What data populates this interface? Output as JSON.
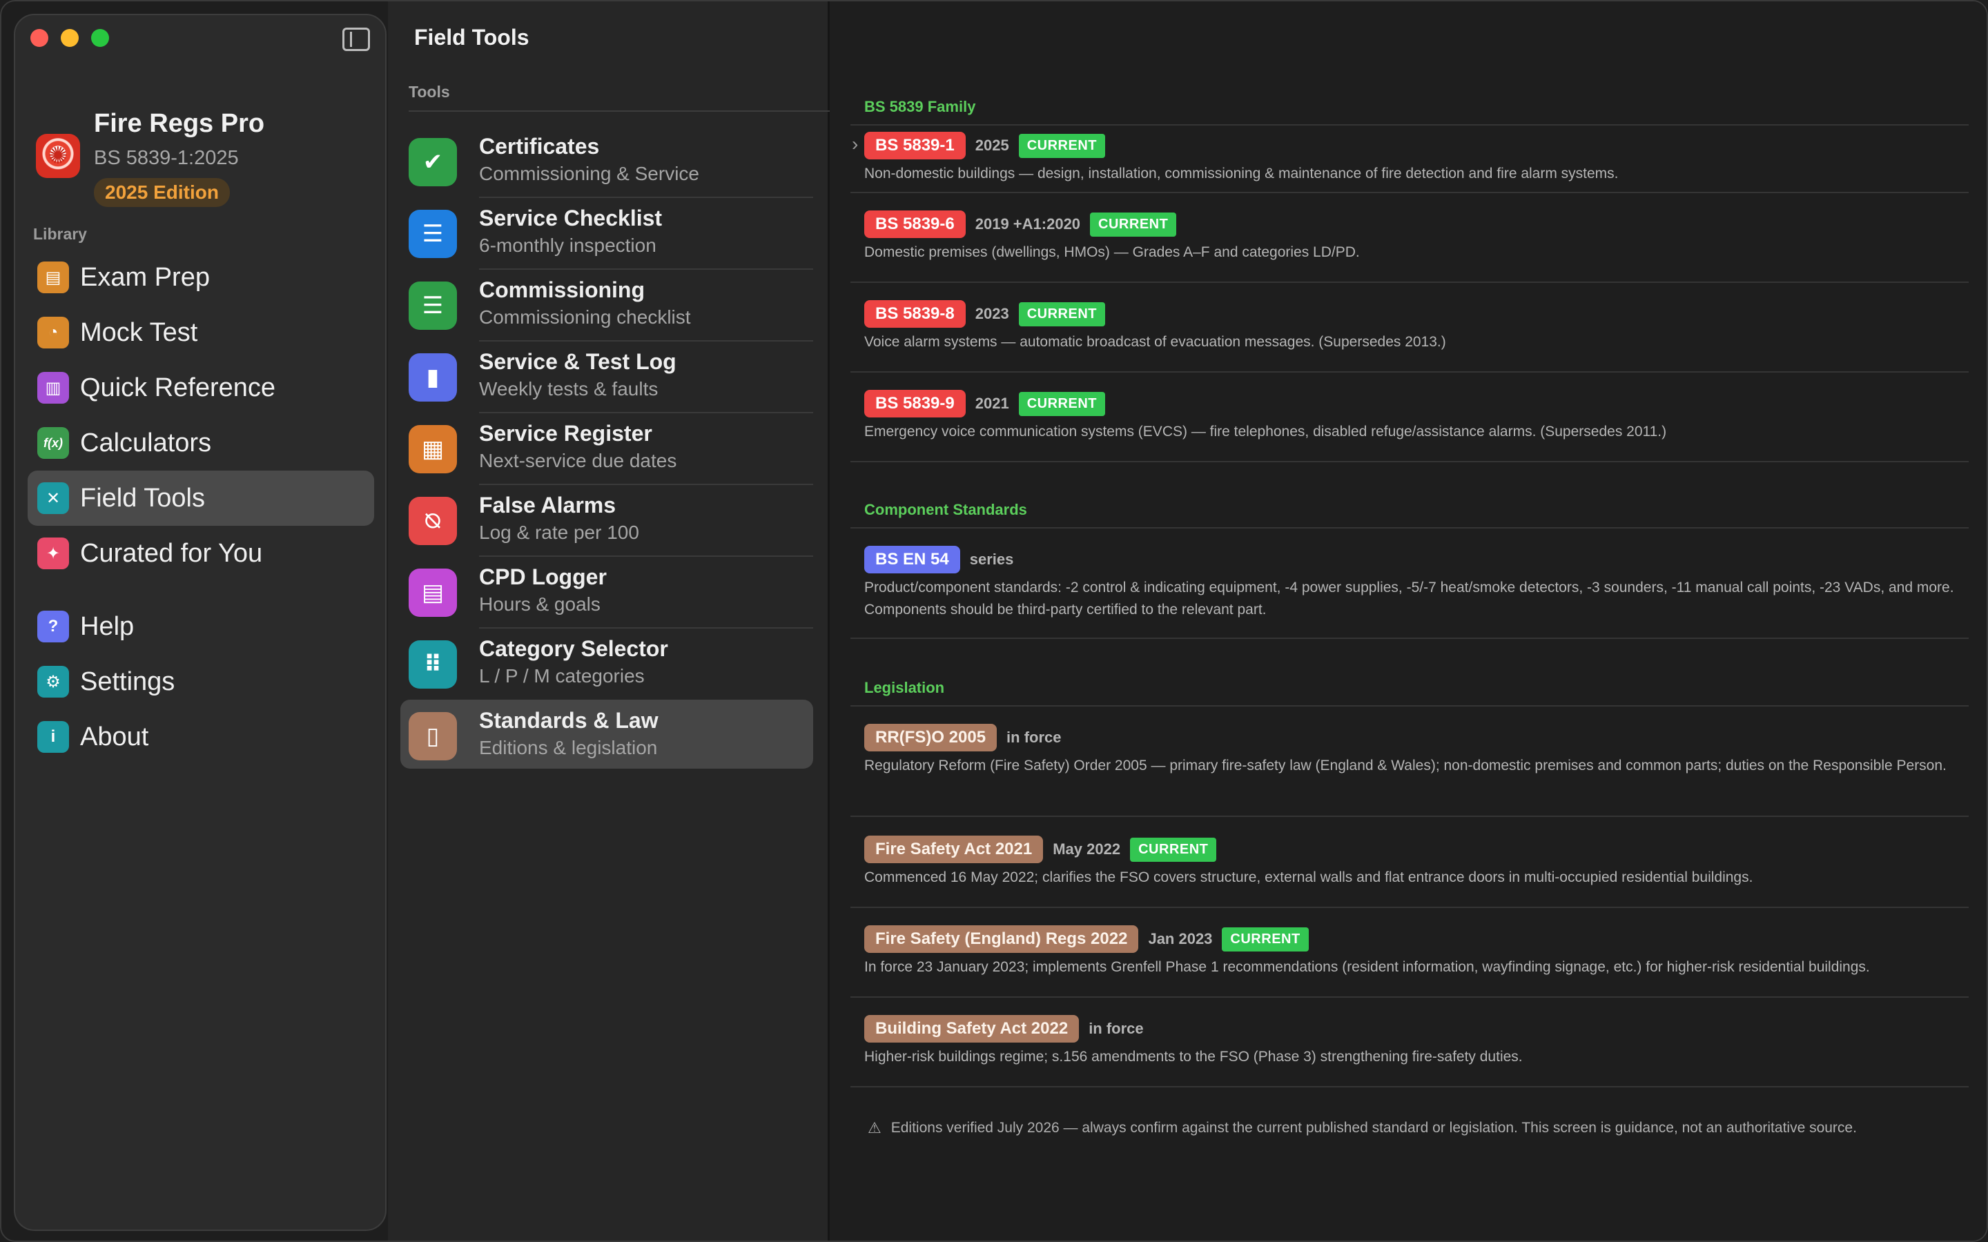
{
  "sidebar": {
    "app_title": "Fire Regs Pro",
    "app_subtitle": "BS 5839-1:2025",
    "edition_badge": "2025 Edition",
    "library_label": "Library",
    "items": [
      {
        "label": "Exam Prep",
        "icon": "clipboard-icon",
        "color": "#d9892b"
      },
      {
        "label": "Mock Test",
        "icon": "timer-icon",
        "color": "#d9892b"
      },
      {
        "label": "Quick Reference",
        "icon": "books-icon",
        "color": "#a551d6"
      },
      {
        "label": "Calculators",
        "icon": "function-icon",
        "color": "#3b9a4d"
      },
      {
        "label": "Field Tools",
        "icon": "wrench-screwdriver-icon",
        "color": "#1c9aa3"
      },
      {
        "label": "Curated for You",
        "icon": "sparkle-icon",
        "color": "#e84a6a"
      }
    ],
    "footer_items": [
      {
        "label": "Help",
        "icon": "question-icon",
        "color": "#6672f0"
      },
      {
        "label": "Settings",
        "icon": "gear-icon",
        "color": "#1c9aa3"
      },
      {
        "label": "About",
        "icon": "info-icon",
        "color": "#1c9aa3"
      }
    ],
    "active": "Field Tools"
  },
  "middle": {
    "title": "Field Tools",
    "tools_label": "Tools",
    "tools": [
      {
        "title": "Certificates",
        "subtitle": "Commissioning & Service",
        "icon": "check-seal-icon",
        "color": "#2f9e48"
      },
      {
        "title": "Service Checklist",
        "subtitle": "6-monthly inspection",
        "icon": "checklist-icon",
        "color": "#1f7fe0"
      },
      {
        "title": "Commissioning",
        "subtitle": "Commissioning checklist",
        "icon": "checklist-icon",
        "color": "#2f9e48"
      },
      {
        "title": "Service & Test Log",
        "subtitle": "Weekly tests & faults",
        "icon": "book-icon",
        "color": "#5b6ee8"
      },
      {
        "title": "Service Register",
        "subtitle": "Next-service due dates",
        "icon": "calendar-clock-icon",
        "color": "#d9782b"
      },
      {
        "title": "False Alarms",
        "subtitle": "Log & rate per 100",
        "icon": "bell-slash-icon",
        "color": "#e54848"
      },
      {
        "title": "CPD Logger",
        "subtitle": "Hours & goals",
        "icon": "document-icon",
        "color": "#c14ad6"
      },
      {
        "title": "Category Selector",
        "subtitle": "L / P / M categories",
        "icon": "grid-icon",
        "color": "#1c9aa3"
      },
      {
        "title": "Standards & Law",
        "subtitle": "Editions & legislation",
        "icon": "book-closed-icon",
        "color": "#a9795f"
      }
    ],
    "active": "Standards & Law"
  },
  "detail": {
    "groups": [
      {
        "title": "BS 5839 Family"
      },
      {
        "title": "Component Standards"
      },
      {
        "title": "Legislation"
      }
    ],
    "current_label": "CURRENT",
    "entries": [
      {
        "code": "BS 5839-1",
        "year": "2025",
        "current": true,
        "desc": "Non-domestic buildings — design, installation, commissioning & maintenance of fire detection and fire alarm systems."
      },
      {
        "code": "BS 5839-6",
        "year": "2019 +A1:2020",
        "current": true,
        "desc": "Domestic premises (dwellings, HMOs) — Grades A–F and categories LD/PD."
      },
      {
        "code": "BS 5839-8",
        "year": "2023",
        "current": true,
        "desc": "Voice alarm systems — automatic broadcast of evacuation messages. (Supersedes 2013.)"
      },
      {
        "code": "BS 5839-9",
        "year": "2021",
        "current": true,
        "desc": "Emergency voice communication systems (EVCS) — fire telephones, disabled refuge/assistance alarms. (Supersedes 2011.)"
      },
      {
        "code": "BS EN 54",
        "year": "series",
        "current": false,
        "desc": "Product/component standards: -2 control & indicating equipment, -4 power supplies, -5/-7 heat/smoke detectors, -3 sounders, -11 manual call points, -23 VADs, and more. Components should be third-party certified to the relevant part."
      },
      {
        "code": "RR(FS)O 2005",
        "year": "in force",
        "current": false,
        "desc": "Regulatory Reform (Fire Safety) Order 2005 — primary fire-safety law (England & Wales); non-domestic premises and common parts; duties on the Responsible Person."
      },
      {
        "code": "Fire Safety Act 2021",
        "year": "May 2022",
        "current": true,
        "desc": "Commenced 16 May 2022; clarifies the FSO covers structure, external walls and flat entrance doors in multi-occupied residential buildings."
      },
      {
        "code": "Fire Safety (England) Regs 2022",
        "year": "Jan 2023",
        "current": true,
        "desc": "In force 23 January 2023; implements Grenfell Phase 1 recommendations (resident information, wayfinding signage, etc.) for higher-risk residential buildings."
      },
      {
        "code": "Building Safety Act 2022",
        "year": "in force",
        "current": false,
        "desc": "Higher-risk buildings regime; s.156 amendments to the FSO (Phase 3) strengthening fire-safety duties."
      }
    ],
    "footnote": "Editions verified July 2026 — always confirm against the current published standard or legislation. This screen is guidance, not an authoritative source."
  }
}
